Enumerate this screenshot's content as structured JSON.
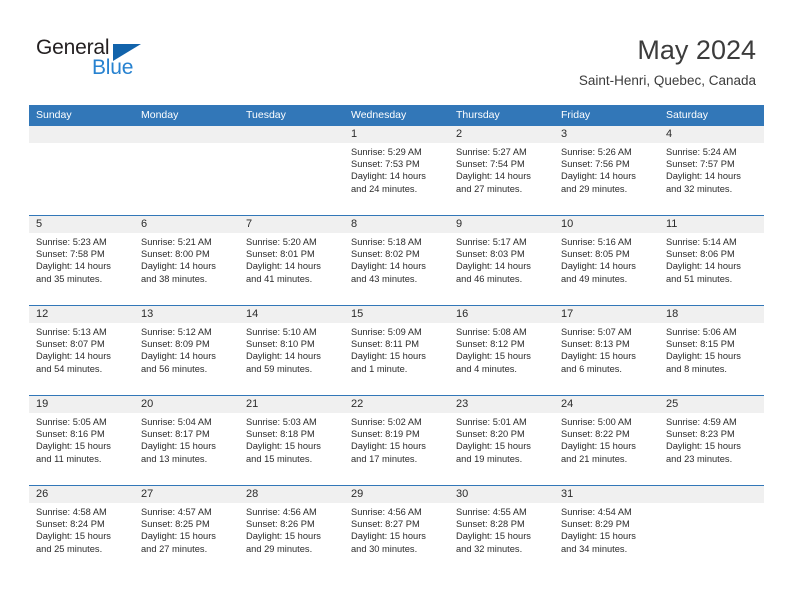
{
  "brand": {
    "name_part1": "General",
    "name_part2": "Blue",
    "accent_color": "#2782d0",
    "triangle_color": "#1263ab"
  },
  "header": {
    "title": "May 2024",
    "subtitle": "Saint-Henri, Quebec, Canada"
  },
  "theme": {
    "header_row_color": "#3277b8",
    "daynum_band_color": "#f0f0f0",
    "text_color": "#2b2b2b"
  },
  "weekdays": [
    "Sunday",
    "Monday",
    "Tuesday",
    "Wednesday",
    "Thursday",
    "Friday",
    "Saturday"
  ],
  "labels": {
    "sunrise_prefix": "Sunrise:",
    "sunset_prefix": "Sunset:",
    "daylight_prefix": "Daylight:"
  },
  "weeks": [
    [
      {
        "day": "",
        "sunrise": "",
        "sunset": "",
        "daylight_line1": "",
        "daylight_line2": ""
      },
      {
        "day": "",
        "sunrise": "",
        "sunset": "",
        "daylight_line1": "",
        "daylight_line2": ""
      },
      {
        "day": "",
        "sunrise": "",
        "sunset": "",
        "daylight_line1": "",
        "daylight_line2": ""
      },
      {
        "day": "1",
        "sunrise": "Sunrise: 5:29 AM",
        "sunset": "Sunset: 7:53 PM",
        "daylight_line1": "Daylight: 14 hours",
        "daylight_line2": "and 24 minutes."
      },
      {
        "day": "2",
        "sunrise": "Sunrise: 5:27 AM",
        "sunset": "Sunset: 7:54 PM",
        "daylight_line1": "Daylight: 14 hours",
        "daylight_line2": "and 27 minutes."
      },
      {
        "day": "3",
        "sunrise": "Sunrise: 5:26 AM",
        "sunset": "Sunset: 7:56 PM",
        "daylight_line1": "Daylight: 14 hours",
        "daylight_line2": "and 29 minutes."
      },
      {
        "day": "4",
        "sunrise": "Sunrise: 5:24 AM",
        "sunset": "Sunset: 7:57 PM",
        "daylight_line1": "Daylight: 14 hours",
        "daylight_line2": "and 32 minutes."
      }
    ],
    [
      {
        "day": "5",
        "sunrise": "Sunrise: 5:23 AM",
        "sunset": "Sunset: 7:58 PM",
        "daylight_line1": "Daylight: 14 hours",
        "daylight_line2": "and 35 minutes."
      },
      {
        "day": "6",
        "sunrise": "Sunrise: 5:21 AM",
        "sunset": "Sunset: 8:00 PM",
        "daylight_line1": "Daylight: 14 hours",
        "daylight_line2": "and 38 minutes."
      },
      {
        "day": "7",
        "sunrise": "Sunrise: 5:20 AM",
        "sunset": "Sunset: 8:01 PM",
        "daylight_line1": "Daylight: 14 hours",
        "daylight_line2": "and 41 minutes."
      },
      {
        "day": "8",
        "sunrise": "Sunrise: 5:18 AM",
        "sunset": "Sunset: 8:02 PM",
        "daylight_line1": "Daylight: 14 hours",
        "daylight_line2": "and 43 minutes."
      },
      {
        "day": "9",
        "sunrise": "Sunrise: 5:17 AM",
        "sunset": "Sunset: 8:03 PM",
        "daylight_line1": "Daylight: 14 hours",
        "daylight_line2": "and 46 minutes."
      },
      {
        "day": "10",
        "sunrise": "Sunrise: 5:16 AM",
        "sunset": "Sunset: 8:05 PM",
        "daylight_line1": "Daylight: 14 hours",
        "daylight_line2": "and 49 minutes."
      },
      {
        "day": "11",
        "sunrise": "Sunrise: 5:14 AM",
        "sunset": "Sunset: 8:06 PM",
        "daylight_line1": "Daylight: 14 hours",
        "daylight_line2": "and 51 minutes."
      }
    ],
    [
      {
        "day": "12",
        "sunrise": "Sunrise: 5:13 AM",
        "sunset": "Sunset: 8:07 PM",
        "daylight_line1": "Daylight: 14 hours",
        "daylight_line2": "and 54 minutes."
      },
      {
        "day": "13",
        "sunrise": "Sunrise: 5:12 AM",
        "sunset": "Sunset: 8:09 PM",
        "daylight_line1": "Daylight: 14 hours",
        "daylight_line2": "and 56 minutes."
      },
      {
        "day": "14",
        "sunrise": "Sunrise: 5:10 AM",
        "sunset": "Sunset: 8:10 PM",
        "daylight_line1": "Daylight: 14 hours",
        "daylight_line2": "and 59 minutes."
      },
      {
        "day": "15",
        "sunrise": "Sunrise: 5:09 AM",
        "sunset": "Sunset: 8:11 PM",
        "daylight_line1": "Daylight: 15 hours",
        "daylight_line2": "and 1 minute."
      },
      {
        "day": "16",
        "sunrise": "Sunrise: 5:08 AM",
        "sunset": "Sunset: 8:12 PM",
        "daylight_line1": "Daylight: 15 hours",
        "daylight_line2": "and 4 minutes."
      },
      {
        "day": "17",
        "sunrise": "Sunrise: 5:07 AM",
        "sunset": "Sunset: 8:13 PM",
        "daylight_line1": "Daylight: 15 hours",
        "daylight_line2": "and 6 minutes."
      },
      {
        "day": "18",
        "sunrise": "Sunrise: 5:06 AM",
        "sunset": "Sunset: 8:15 PM",
        "daylight_line1": "Daylight: 15 hours",
        "daylight_line2": "and 8 minutes."
      }
    ],
    [
      {
        "day": "19",
        "sunrise": "Sunrise: 5:05 AM",
        "sunset": "Sunset: 8:16 PM",
        "daylight_line1": "Daylight: 15 hours",
        "daylight_line2": "and 11 minutes."
      },
      {
        "day": "20",
        "sunrise": "Sunrise: 5:04 AM",
        "sunset": "Sunset: 8:17 PM",
        "daylight_line1": "Daylight: 15 hours",
        "daylight_line2": "and 13 minutes."
      },
      {
        "day": "21",
        "sunrise": "Sunrise: 5:03 AM",
        "sunset": "Sunset: 8:18 PM",
        "daylight_line1": "Daylight: 15 hours",
        "daylight_line2": "and 15 minutes."
      },
      {
        "day": "22",
        "sunrise": "Sunrise: 5:02 AM",
        "sunset": "Sunset: 8:19 PM",
        "daylight_line1": "Daylight: 15 hours",
        "daylight_line2": "and 17 minutes."
      },
      {
        "day": "23",
        "sunrise": "Sunrise: 5:01 AM",
        "sunset": "Sunset: 8:20 PM",
        "daylight_line1": "Daylight: 15 hours",
        "daylight_line2": "and 19 minutes."
      },
      {
        "day": "24",
        "sunrise": "Sunrise: 5:00 AM",
        "sunset": "Sunset: 8:22 PM",
        "daylight_line1": "Daylight: 15 hours",
        "daylight_line2": "and 21 minutes."
      },
      {
        "day": "25",
        "sunrise": "Sunrise: 4:59 AM",
        "sunset": "Sunset: 8:23 PM",
        "daylight_line1": "Daylight: 15 hours",
        "daylight_line2": "and 23 minutes."
      }
    ],
    [
      {
        "day": "26",
        "sunrise": "Sunrise: 4:58 AM",
        "sunset": "Sunset: 8:24 PM",
        "daylight_line1": "Daylight: 15 hours",
        "daylight_line2": "and 25 minutes."
      },
      {
        "day": "27",
        "sunrise": "Sunrise: 4:57 AM",
        "sunset": "Sunset: 8:25 PM",
        "daylight_line1": "Daylight: 15 hours",
        "daylight_line2": "and 27 minutes."
      },
      {
        "day": "28",
        "sunrise": "Sunrise: 4:56 AM",
        "sunset": "Sunset: 8:26 PM",
        "daylight_line1": "Daylight: 15 hours",
        "daylight_line2": "and 29 minutes."
      },
      {
        "day": "29",
        "sunrise": "Sunrise: 4:56 AM",
        "sunset": "Sunset: 8:27 PM",
        "daylight_line1": "Daylight: 15 hours",
        "daylight_line2": "and 30 minutes."
      },
      {
        "day": "30",
        "sunrise": "Sunrise: 4:55 AM",
        "sunset": "Sunset: 8:28 PM",
        "daylight_line1": "Daylight: 15 hours",
        "daylight_line2": "and 32 minutes."
      },
      {
        "day": "31",
        "sunrise": "Sunrise: 4:54 AM",
        "sunset": "Sunset: 8:29 PM",
        "daylight_line1": "Daylight: 15 hours",
        "daylight_line2": "and 34 minutes."
      },
      {
        "day": "",
        "sunrise": "",
        "sunset": "",
        "daylight_line1": "",
        "daylight_line2": ""
      }
    ]
  ]
}
